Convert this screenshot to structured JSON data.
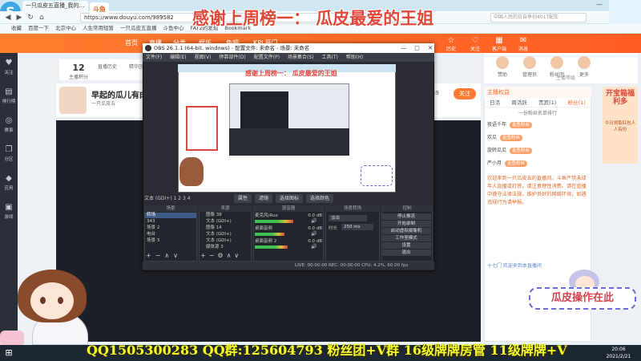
{
  "browser": {
    "tab_title": "一只瓜皮五直播_我的小…",
    "url": "https://www.douyu.com/989582",
    "search_placeholder": "中国人民的日自争创401T配车",
    "bookmarks": [
      "收藏",
      "百度一下",
      "北京中心",
      "人生常用短暂",
      "一只瓜皮五直播",
      "斗鱼中心",
      "FAT2的发现",
      "Bookmark"
    ]
  },
  "douyu": {
    "logo": "斗鱼",
    "nav": [
      "首页",
      "直播",
      "分类",
      "娱乐",
      "鱼吧",
      "KPL开门"
    ],
    "header_icons": [
      {
        "glyph": "☆",
        "label": "历史"
      },
      {
        "glyph": "♡",
        "label": "关注"
      },
      {
        "glyph": "▦",
        "label": "客户端"
      },
      {
        "glyph": "✉",
        "label": "消息"
      }
    ],
    "sidebar": [
      {
        "glyph": "♥",
        "label": "关注"
      },
      {
        "glyph": "▤",
        "label": "排行榜"
      },
      {
        "glyph": "◎",
        "label": "赛事"
      },
      {
        "glyph": "❐",
        "label": "分区"
      },
      {
        "glyph": "◆",
        "label": "应用"
      },
      {
        "glyph": "▣",
        "label": "游戏"
      }
    ],
    "room_stats": [
      {
        "value": "12",
        "label": "主播积分"
      },
      {
        "value": "",
        "label": "直播历史"
      },
      {
        "value": "",
        "label": "精华区"
      }
    ],
    "room_title": "早起的瓜儿有肉吃",
    "room_sub": "一只瓜皮五",
    "follow": "关注",
    "follow_count": "3849",
    "right_icons": [
      {
        "label": "赞助"
      },
      {
        "label": "管理员"
      },
      {
        "label": "粉丝团"
      },
      {
        "label": "更多"
      }
    ],
    "anchor_badge": "主播等级",
    "right_panel": {
      "header": "主播权益",
      "tabs": [
        "日活",
        "周活跃",
        "贵宾(1)",
        "粉丝(1)"
      ],
      "rank_sub": "一份粉丝名单排行",
      "chat": [
        {
          "name": "夜语千年",
          "badge": "金鱼粉丝"
        },
        {
          "name": "欢瓜",
          "badge": "金鱼粉丝"
        },
        {
          "name": "旋转瓜瓜",
          "badge": "金鱼粉丝"
        },
        {
          "name": "严小月",
          "badge": "金鱼粉丝"
        }
      ],
      "notice": "欢迎来到一只瓜皮五的直播间。斗鱼严禁未成年人直播或打赏，请注意理性消费。请在直播中遵守法律法规，维护良好的网络环境，如遇违规行为请举报。",
      "enter_line": "十七门 欢迎来到本直播间"
    },
    "side_ad": {
      "title": "开宝箱福利多",
      "text": "今日领取红包人人有份"
    }
  },
  "banners": {
    "top": "感谢上周榜一：  瓜皮最爱的王姐",
    "nested_top": "感谢上周榜一： 瓜皮最爱的王姐",
    "bottom": "QQ1505300283  QQ群:125604793  粉丝团+V群 16级牌牌房管 11级牌牌+V",
    "sticker": "瓜皮操作在此"
  },
  "obs": {
    "title": "OBS 26.1.1 (64-bit, windows) - 配置文件: 未命名 - 场景: 未命名",
    "menu": [
      "文件(F)",
      "编辑(E)",
      "视图(V)",
      "停靠部件(D)",
      "配置文件(P)",
      "场景集合(S)",
      "工具(T)",
      "帮助(H)"
    ],
    "text_source_label": "文本 (GDI+) 1 2 3 4",
    "toolbar": [
      "属性",
      "滤镜",
      "选择图标",
      "选择颜色"
    ],
    "docks": {
      "scenes_title": "场景",
      "sources_title": "来源",
      "mixer_title": "混音器",
      "transitions_title": "场景转场",
      "controls_title": "控制"
    },
    "scenes": [
      "转场",
      "343",
      "场景 2",
      "电台",
      "场景 3"
    ],
    "sources": [
      "图像 38",
      "文本 (GDI+)",
      "图像 14",
      "文本 (GDI+)",
      "文本 (GDI+)",
      "媒体源 3"
    ],
    "mixer": [
      {
        "name": "麦克风/Aux",
        "db": "0.0 dB",
        "level": 0.7
      },
      {
        "name": "桌面音频",
        "db": "0.0 dB",
        "level": 0.55
      },
      {
        "name": "桌面音频 2",
        "db": "0.0 dB",
        "level": 0.6
      }
    ],
    "transition": {
      "type": "淡出",
      "duration_label": "时长",
      "duration": "250 ms"
    },
    "controls": [
      "停止推流",
      "开始录制",
      "启动虚拟摄像机",
      "工作室模式",
      "设置",
      "退出"
    ],
    "status": "LIVE: 00:00:00   REC: 00:00:00   CPU: 4.2%, 60.00 fps"
  },
  "taskbar": {
    "start": "⊞",
    "time": "20:06",
    "date": "2021/2/21"
  },
  "top_left_deco": "S"
}
